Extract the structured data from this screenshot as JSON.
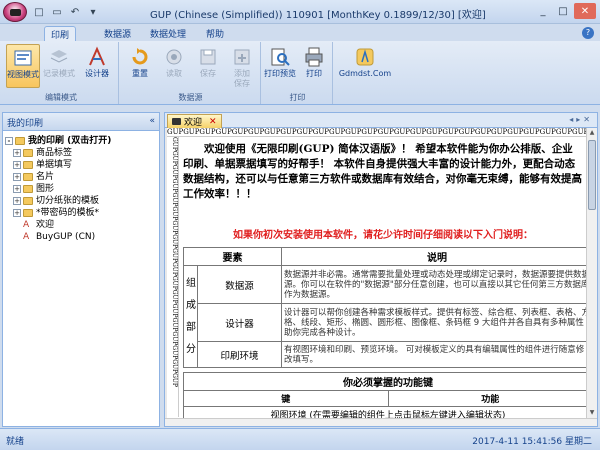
{
  "window": {
    "title": "GUP (Chinese (Simplified)) 110901 [MonthKey 0.1899/12/30] [欢迎]",
    "controls": [
      "_",
      "□",
      "✕"
    ]
  },
  "quick_access": [
    "□",
    "▭",
    "↶",
    "▾"
  ],
  "ribbon_tabs": [
    "印刷",
    "数据源",
    "数据处理",
    "帮助"
  ],
  "ribbon": {
    "groups": [
      {
        "label": "编辑模式",
        "buttons": [
          {
            "label": "视图模式",
            "icon": "view-mode-icon",
            "state": "pressed"
          },
          {
            "label": "记录模式",
            "icon": "record-mode-icon",
            "state": "disabled"
          },
          {
            "label": "设计器",
            "icon": "designer-icon",
            "state": "normal"
          }
        ]
      },
      {
        "label": "数据源",
        "buttons": [
          {
            "label": "重置",
            "icon": "reset-icon",
            "state": "normal"
          },
          {
            "label": "读取",
            "icon": "read-icon",
            "state": "disabled"
          },
          {
            "label": "保存",
            "icon": "save-icon",
            "state": "disabled"
          },
          {
            "label": "添加\n保存",
            "icon": "add-save-icon",
            "state": "disabled"
          }
        ]
      },
      {
        "label": "打印",
        "buttons": [
          {
            "label": "打印预览",
            "icon": "print-preview-icon",
            "state": "normal"
          },
          {
            "label": "打印",
            "icon": "print-icon",
            "state": "normal"
          }
        ]
      },
      {
        "label": "",
        "buttons": [
          {
            "label": "Gdmdst.Com",
            "icon": "gdmdst-icon",
            "state": "normal"
          }
        ]
      }
    ]
  },
  "left_panel": {
    "title": "我的印刷",
    "tree": [
      {
        "label": "我的印刷 (双击打开)",
        "level": 0,
        "type": "root"
      },
      {
        "label": "商品标签",
        "level": 1,
        "type": "folder"
      },
      {
        "label": "单据填写",
        "level": 1,
        "type": "folder"
      },
      {
        "label": "名片",
        "level": 1,
        "type": "folder"
      },
      {
        "label": "图形",
        "level": 1,
        "type": "folder"
      },
      {
        "label": "切分纸张的模板",
        "level": 1,
        "type": "folder"
      },
      {
        "label": "*带密码的模板*",
        "level": 1,
        "type": "folder"
      },
      {
        "label": "欢迎",
        "level": 1,
        "type": "doc"
      },
      {
        "label": "BuyGUP (CN)",
        "level": 1,
        "type": "doc"
      }
    ]
  },
  "doc_tab": {
    "label": "欢迎",
    "close": "✕"
  },
  "doc": {
    "ruler_text": "GUPGUPGUPGUPGUPGUPGUPGUPGUPGUPGUPGUPGUPGUPGUPGUPGUPGUPGUPGUPGUPGUPGUPGUPGUPGUPGUPGUPGUPGUPGUPGUPGUPGUP",
    "ruler_left": "GUPGUPGUPGUPGUPGUPGUPGUPGUPGUPGUPGUPGUPGUPGUPGUPGUPGUP",
    "intro": "欢迎使用《无限印刷(GUP) 简体汉语版》！ 希望本软件能为你办公排版、企业印刷、单据票据填写的好帮手！ 本软件自身提供强大丰富的设计能力外，更配合动态数据结构，还可以与任意第三方软件或数据库有效结合，对你毫无束缚，能够有效提高工作效率！！！",
    "notice": "如果你初次安装使用本软件，请花少许时间仔细阅读以下入门说明：",
    "table_headers": [
      "要素",
      "说明"
    ],
    "category": "组成部分",
    "rows": [
      {
        "elem": "数据源",
        "desc": "数据源并非必需。通常需要批量处理或动态处理或绑定记录时，数据源要提供数据源。你可以在软件的\"数据源\"部分任意创建，也可以直接以其它任何第三方数据库作为数据源。"
      },
      {
        "elem": "设计器",
        "desc": "设计器可以帮你创建各种需求模板样式。提供有标签、综合框、列表框、表格、方格、线段、矩形、椭圆、圆形框、图像框、条码框 9 大组件并各自具有多种属性助你完成各种设计。"
      },
      {
        "elem": "印刷环境",
        "desc": "有视图环境和印刷、预览环境。 可对模板定义的具有编辑属性的组件进行随意修改填写。"
      }
    ],
    "keys_caption": "你必须掌握的功能键",
    "keys_headers": [
      "键",
      "功能"
    ],
    "keys_row": "视图环境 (在需要编辑的组件上点击鼠标左键进入编辑状态)"
  },
  "status": {
    "left": "就绪",
    "right": "2017-4-11 15:41:56 星期二"
  }
}
